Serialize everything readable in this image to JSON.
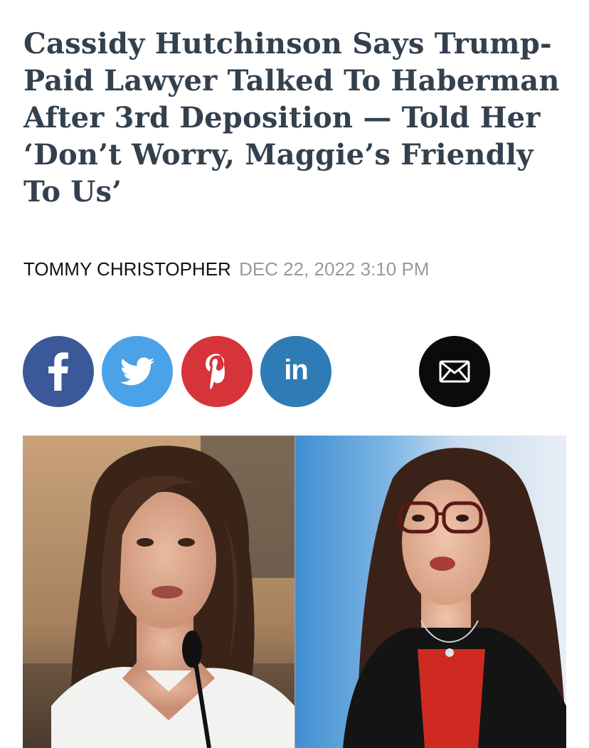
{
  "article": {
    "headline": "Cassidy Hutchinson Says Trump-Paid Lawyer Talked To Haberman After 3rd Deposition — Told Her ‘Don’t Worry, Maggie’s Friendly To Us’",
    "author": "TOMMY CHRISTOPHER",
    "date": "DEC 22, 2022 3:10 PM"
  },
  "share": {
    "facebook": {
      "icon": "facebook-icon",
      "color": "#3b5898"
    },
    "twitter": {
      "icon": "twitter-icon",
      "color": "#4aa2e8"
    },
    "pinterest": {
      "icon": "pinterest-icon",
      "color": "#d6333a"
    },
    "linkedin": {
      "icon": "linkedin-icon",
      "label": "in",
      "color": "#2f7bb5"
    },
    "email": {
      "icon": "envelope-icon",
      "color": "#0b0b0b"
    }
  }
}
